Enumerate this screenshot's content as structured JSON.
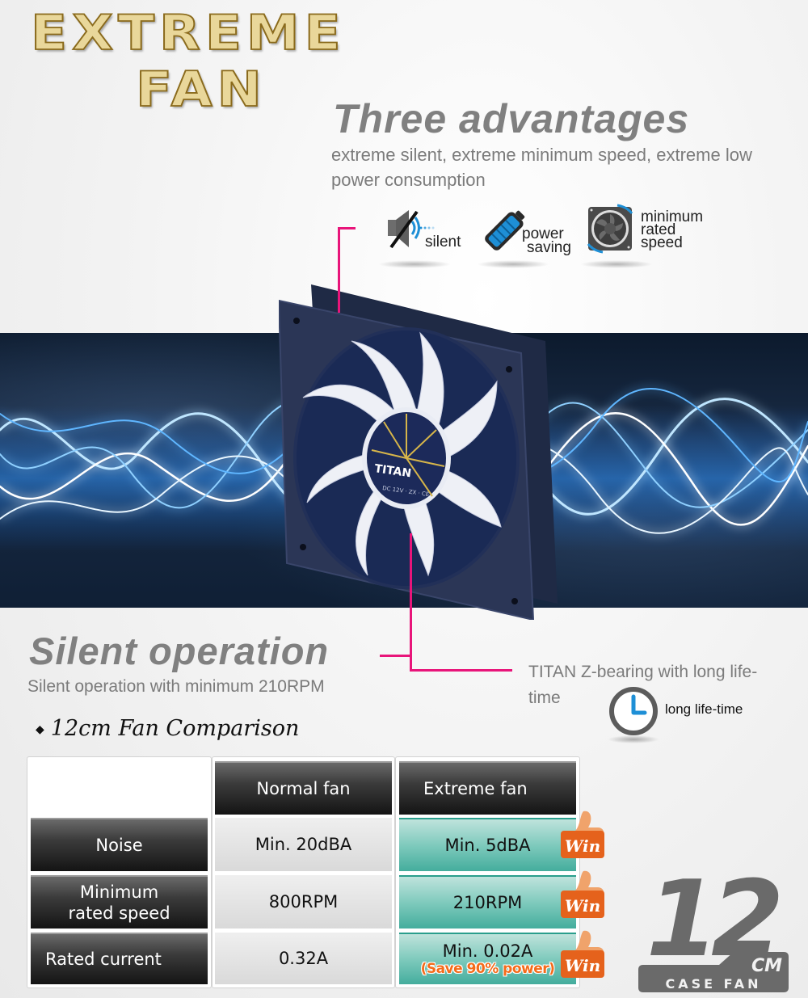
{
  "logo": {
    "line1": "EXTREME",
    "line2": "FAN"
  },
  "advantages": {
    "title": "Three advantages",
    "subtitle": "extreme silent, extreme minimum speed, extreme low power consumption",
    "features": [
      {
        "icon": "muted-speaker-icon",
        "label": "silent"
      },
      {
        "icon": "battery-icon",
        "label_line1": "power",
        "label_line2": "saving"
      },
      {
        "icon": "fan-icon",
        "label_line1": "minimum",
        "label_line2": "rated",
        "label_line3": "speed"
      }
    ]
  },
  "product": {
    "hub_brand": "TITAN",
    "hub_spec": "DC 12V · ZX · CE"
  },
  "silent": {
    "title": "Silent operation",
    "subtitle": "Silent operation with minimum 210RPM"
  },
  "bearing": {
    "text": "TITAN Z-bearing with long life-time",
    "icon": "clock-icon",
    "icon_label": "long life-time"
  },
  "comparison": {
    "title": "12cm Fan Comparison",
    "bullet": "◆",
    "columns": [
      "",
      "Normal fan",
      "Extreme fan"
    ],
    "rows": [
      {
        "label": "Noise",
        "normal": "Min. 20dBA",
        "extreme": "Min. 5dBA",
        "extreme_note": "",
        "badge": "Win"
      },
      {
        "label": "Minimum rated speed",
        "label_line1": "Minimum",
        "label_line2": "rated speed",
        "normal": "800RPM",
        "extreme": "210RPM",
        "extreme_note": "",
        "badge": "Win"
      },
      {
        "label": "Rated current",
        "normal": "0.32A",
        "extreme": "Min. 0.02A",
        "extreme_note": "(Save 90% power)",
        "badge": "Win"
      }
    ]
  },
  "badge_12cm": {
    "number": "12",
    "unit": "CM",
    "caption": "CASE FAN"
  },
  "colors": {
    "accent_pink": "#e8157a",
    "icon_blue": "#1e8fd6",
    "teal": "#44ad9d",
    "win_orange": "#e5621c",
    "heading_grey": "#808080"
  }
}
